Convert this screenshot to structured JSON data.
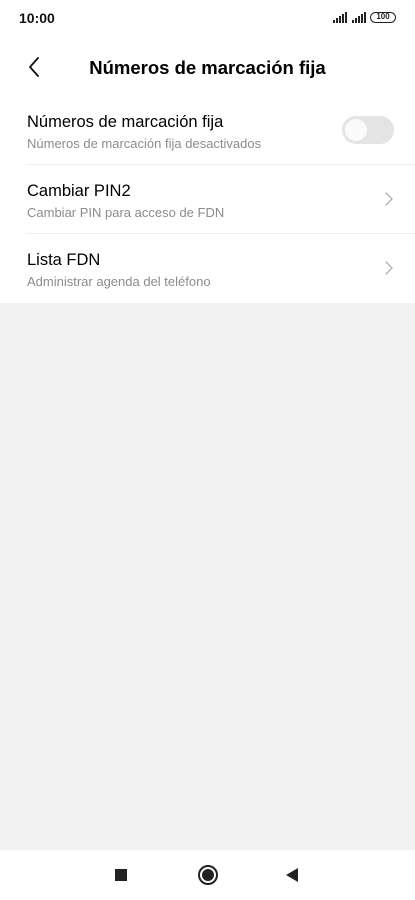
{
  "status_bar": {
    "time": "10:00",
    "battery": "100",
    "icons": [
      "signal-icon",
      "signal-icon",
      "battery-icon"
    ]
  },
  "app_bar": {
    "title": "Números de marcación fija",
    "back_icon": "chevron-left-icon"
  },
  "settings": [
    {
      "title": "Números de marcación fija",
      "subtitle": "Números de marcación fija desactivados",
      "control": "toggle",
      "toggle_on": false
    },
    {
      "title": "Cambiar PIN2",
      "subtitle": "Cambiar PIN para acceso de FDN",
      "control": "chevron-right-icon"
    },
    {
      "title": "Lista FDN",
      "subtitle": "Administrar agenda del teléfono",
      "control": "chevron-right-icon"
    }
  ],
  "nav_bar": {
    "icons": [
      "square-recents-icon",
      "circle-home-icon",
      "triangle-back-icon"
    ]
  },
  "colors": {
    "background": "#f2f2f2",
    "surface": "#ffffff",
    "subtitle_text": "#8c8c8c",
    "toggle_off_track": "#e4e4e4"
  }
}
